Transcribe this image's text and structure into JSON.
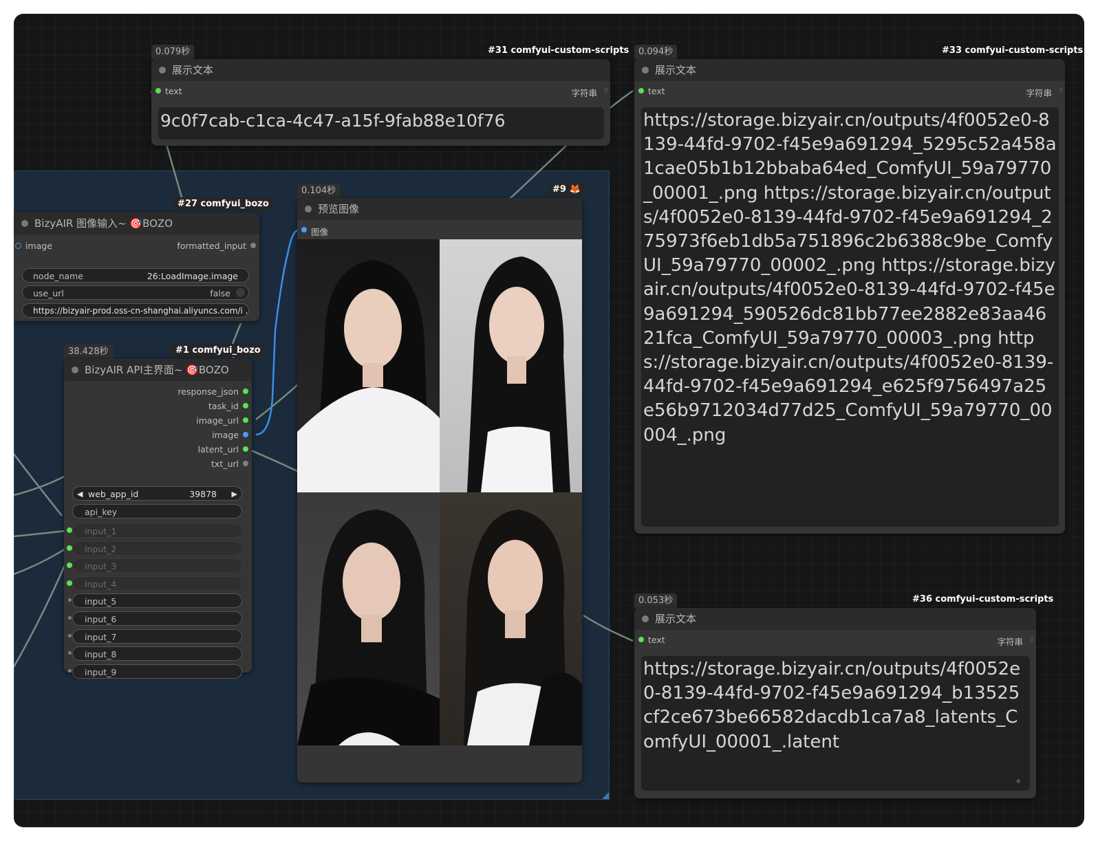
{
  "colors": {
    "canvas_bg": "#151617",
    "group_bg": "#1b2b3b",
    "node_bg": "#353535",
    "node_header": "#2b2b2b",
    "slot_green": "#5ae25a",
    "slot_blue": "#4d9bff",
    "link_blue": "#3b8eea",
    "link_gray": "#8a9a8a"
  },
  "nodes": {
    "n31": {
      "time": "0.079秒",
      "tag": "#31 comfyui-custom-scripts",
      "title": "展示文本",
      "input_label": "text",
      "type_label": "字符串",
      "value": "9c0f7cab-c1ca-4c47-a15f-9fab88e10f76"
    },
    "n33": {
      "time": "0.094秒",
      "tag": "#33 comfyui-custom-scripts",
      "title": "展示文本",
      "input_label": "text",
      "type_label": "字符串",
      "value": "https://storage.bizyair.cn/outputs/4f0052e0-8139-44fd-9702-f45e9a691294_5295c52a458a1cae05b1b12bbaba64ed_ComfyUI_59a79770_00001_.png https://storage.bizyair.cn/outputs/4f0052e0-8139-44fd-9702-f45e9a691294_275973f6eb1db5a751896c2b6388c9be_ComfyUI_59a79770_00002_.png https://storage.bizyair.cn/outputs/4f0052e0-8139-44fd-9702-f45e9a691294_590526dc81bb77ee2882e83aa4621fca_ComfyUI_59a79770_00003_.png https://storage.bizyair.cn/outputs/4f0052e0-8139-44fd-9702-f45e9a691294_e625f9756497a25e56b9712034d77d25_ComfyUI_59a79770_00004_.png"
    },
    "n36": {
      "time": "0.053秒",
      "tag": "#36 comfyui-custom-scripts",
      "title": "展示文本",
      "input_label": "text",
      "type_label": "字符串",
      "value": "https://storage.bizyair.cn/outputs/4f0052e0-8139-44fd-9702-f45e9a691294_b13525cf2ce673be66582dacdb1ca7a8_latents_ComfyUI_00001_.latent"
    },
    "n27": {
      "tag": "#27 comfyui_bozo",
      "title": "BizyAIR 图像输入~ 🎯BOZO",
      "input_label": "image",
      "output_label": "formatted_input",
      "widgets": {
        "node_name_label": "node_name",
        "node_name_value": "26:LoadImage.image",
        "use_url_label": "use_url",
        "use_url_value": "false",
        "url_value": "https://bizyair-prod.oss-cn-shanghai.aliyuncs.com/i ..."
      }
    },
    "n9": {
      "time": "0.104秒",
      "tag": "#9 🦊",
      "title": "预览图像",
      "input_label": "图像"
    },
    "n1": {
      "time": "38.428秒",
      "tag": "#1 comfyui_bozo",
      "title": "BizyAIR API主界面~ 🎯BOZO",
      "outputs": [
        "response_json",
        "task_id",
        "image_url",
        "image",
        "latent_url",
        "txt_url"
      ],
      "web_app_id_label": "web_app_id",
      "web_app_id_value": "39878",
      "api_key_label": "api_key",
      "inputs": [
        "input_1",
        "input_2",
        "input_3",
        "input_4",
        "input_5",
        "input_6",
        "input_7",
        "input_8",
        "input_9"
      ]
    }
  }
}
